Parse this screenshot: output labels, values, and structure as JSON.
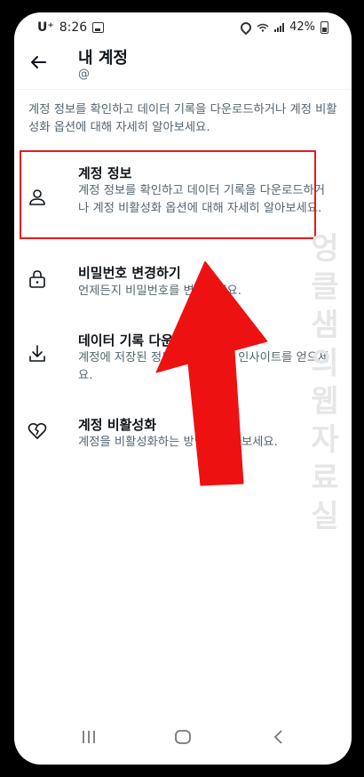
{
  "status_bar": {
    "carrier": "U⁺",
    "time": "8:26",
    "battery": "42%"
  },
  "header": {
    "title": "내 계정",
    "handle": "@"
  },
  "description": "계정 정보를 확인하고 데이터 기록을 다운로드하거나 계정 비활성화 옵션에 대해 자세히 알아보세요.",
  "menu": [
    {
      "label": "계정 정보",
      "sub": "계정 정보를 확인하고 데이터 기록을 다운로드하거나 계정 비활성화 옵션에 대해 자세히 알아보세요.",
      "icon": "person-icon"
    },
    {
      "label": "비밀번호 변경하기",
      "sub": "언제든지 비밀번호를 변경하세요.",
      "icon": "lock-icon"
    },
    {
      "label": "데이터 기록 다운로드",
      "sub": "계정에 저장된 정보 유형에 대한 인사이트를 얻으세요.",
      "icon": "download-icon"
    },
    {
      "label": "계정 비활성화",
      "sub": "계정을 비활성화하는 방법을 알아보세요.",
      "icon": "broken-heart-icon"
    }
  ],
  "watermark": "엉클샘의웹자료실",
  "accent_color": "#e41b1b"
}
